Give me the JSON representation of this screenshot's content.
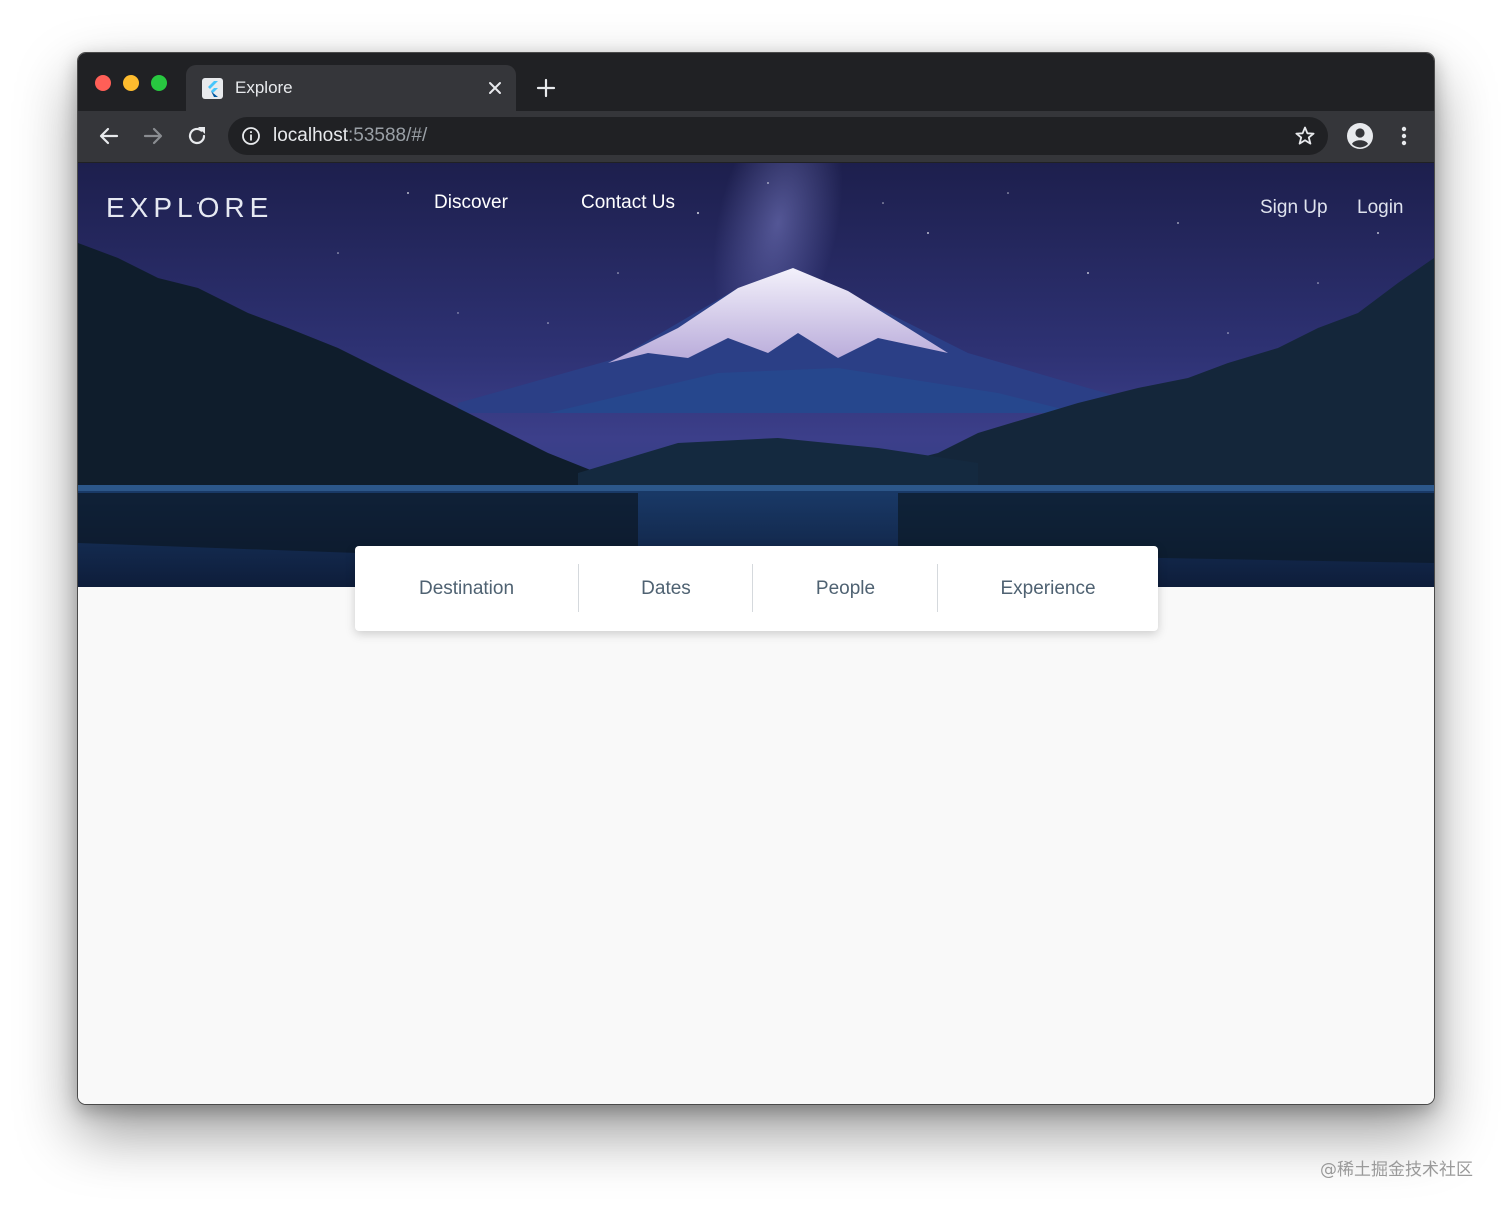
{
  "browser": {
    "tab_title": "Explore",
    "url_host": "localhost",
    "url_rest": ":53588/#/",
    "icons": {
      "back": "back-arrow-icon",
      "forward": "forward-arrow-icon",
      "reload": "reload-icon",
      "info": "info-icon",
      "star": "bookmark-star-icon",
      "profile": "profile-avatar-icon",
      "menu": "kebab-menu-icon",
      "close_tab": "close-icon",
      "new_tab": "plus-icon",
      "favicon": "flutter-logo-icon"
    }
  },
  "app": {
    "logo": "EXPLORE",
    "nav": {
      "discover": "Discover",
      "contact": "Contact Us",
      "signup": "Sign Up",
      "login": "Login"
    },
    "search": {
      "destination": "Destination",
      "dates": "Dates",
      "people": "People",
      "experience": "Experience"
    }
  },
  "watermark": "@稀土掘金技术社区",
  "colors": {
    "chrome_dark": "#202124",
    "chrome_tab": "#35363a",
    "search_text": "#4f6272",
    "page_bg": "#f9f9f9"
  }
}
